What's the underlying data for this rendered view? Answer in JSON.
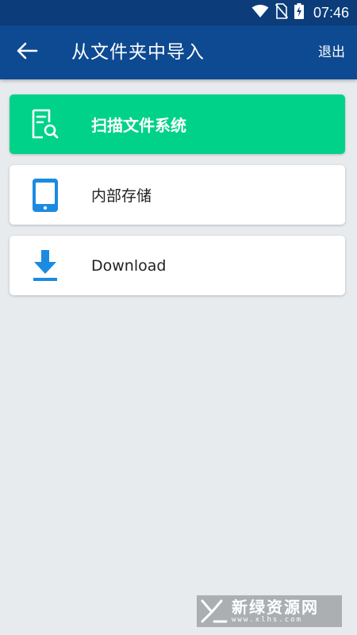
{
  "status_bar": {
    "time": "07:46",
    "icons": [
      "wifi-icon",
      "no-sim-icon",
      "battery-charging-icon"
    ]
  },
  "header": {
    "title": "从文件夹中导入",
    "exit_label": "退出",
    "back_icon": "arrow-left-icon"
  },
  "items": [
    {
      "label": "扫描文件系统",
      "icon": "scan-file-icon",
      "selected": true
    },
    {
      "label": "内部存储",
      "icon": "phone-icon",
      "selected": false
    },
    {
      "label": "Download",
      "icon": "download-icon",
      "selected": false
    }
  ],
  "colors": {
    "status_bar": "#0c3d7a",
    "app_bar": "#0d4a91",
    "selected_item": "#00d28a",
    "icon_blue": "#1a8be0",
    "background": "#e8ebee"
  },
  "watermark": {
    "name": "新绿资源网",
    "url": "www.xlhs.com"
  }
}
